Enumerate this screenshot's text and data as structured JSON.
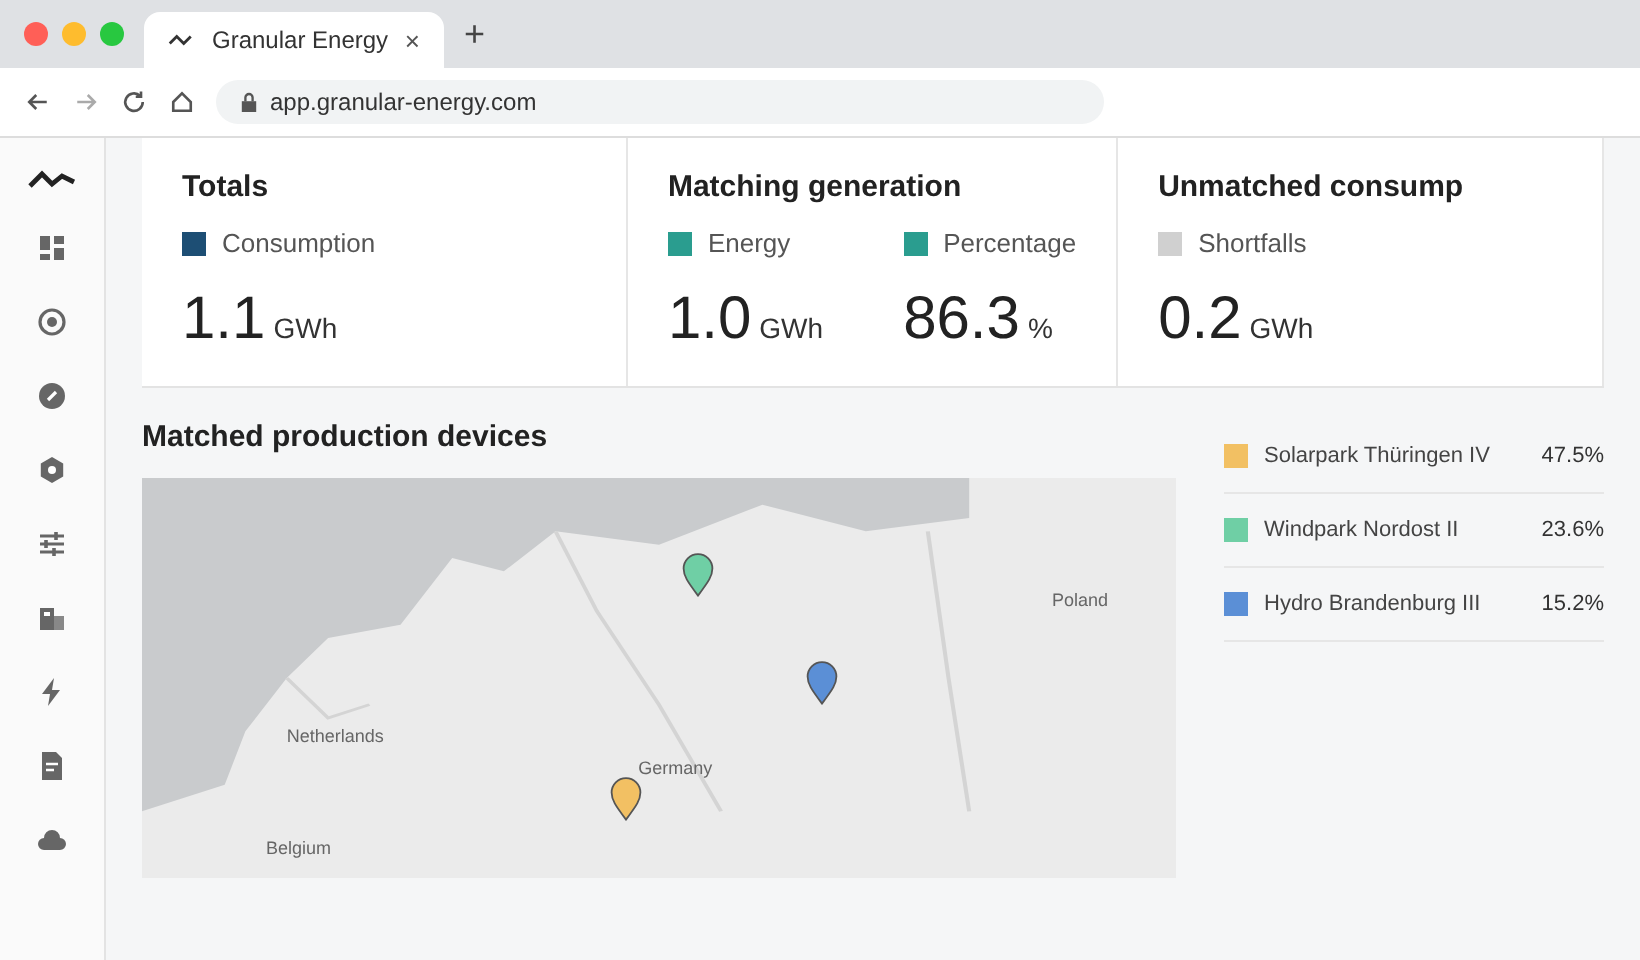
{
  "browser": {
    "tab_title": "Granular Energy",
    "tab_close": "×",
    "new_tab": "+",
    "url": "app.granular-energy.com"
  },
  "stats": [
    {
      "title": "Totals",
      "metrics": [
        {
          "label": "Consumption",
          "color": "#1d4e74",
          "value": "1.1",
          "unit": "GWh"
        }
      ]
    },
    {
      "title": "Matching generation",
      "metrics": [
        {
          "label": "Energy",
          "color": "#2a9d8f",
          "value": "1.0",
          "unit": "GWh"
        },
        {
          "label": "Percentage",
          "color": "#2a9d8f",
          "value": "86.3",
          "unit": "%"
        }
      ]
    },
    {
      "title": "Unmatched consump",
      "metrics": [
        {
          "label": "Shortfalls",
          "color": "#d0d0d0",
          "value": "0.2",
          "unit": "GWh"
        }
      ]
    }
  ],
  "devices_section": {
    "title": "Matched production devices",
    "map": {
      "labels": [
        "Netherlands",
        "Germany",
        "Belgium",
        "Poland"
      ],
      "pins": [
        {
          "color": "#6fcfa5"
        },
        {
          "color": "#5b8fd6"
        },
        {
          "color": "#f2c063"
        }
      ]
    },
    "devices": [
      {
        "name": "Solarpark Thüringen IV",
        "share": "47.5%",
        "color": "#f2c063"
      },
      {
        "name": "Windpark Nordost II",
        "share": "23.6%",
        "color": "#6fcfa5"
      },
      {
        "name": "Hydro Brandenburg III",
        "share": "15.2%",
        "color": "#5b8fd6"
      }
    ]
  }
}
